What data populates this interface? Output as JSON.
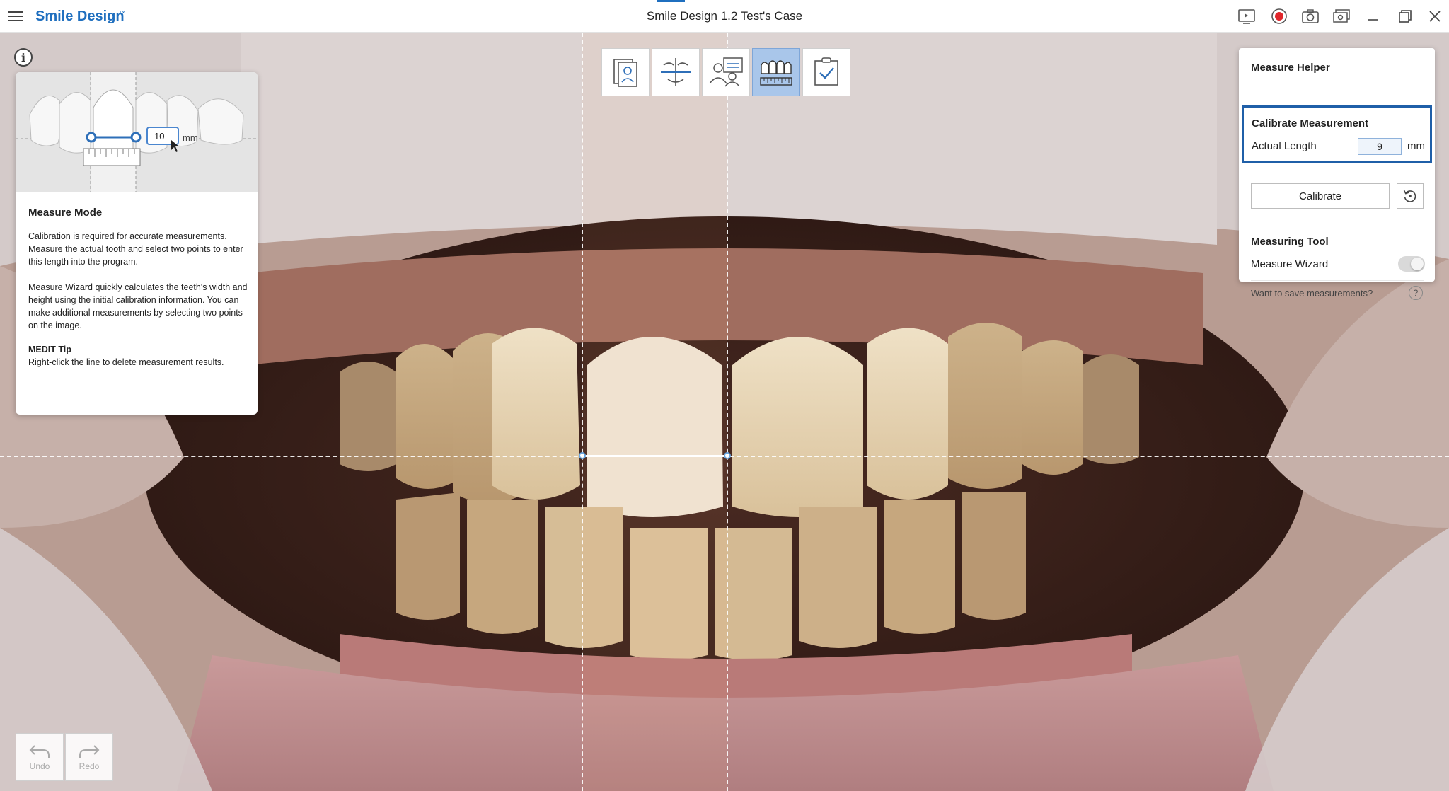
{
  "app": {
    "name": "Smile Design",
    "badge": "™",
    "case_title": "Smile Design 1.2 Test's Case"
  },
  "titlebar_icons": [
    "video-guide-icon",
    "record-icon",
    "camera-icon",
    "screen-capture-icon",
    "minimize-icon",
    "maximize-icon",
    "close-icon"
  ],
  "help_card": {
    "illustration_value": "10",
    "illustration_unit": "mm",
    "heading": "Measure Mode",
    "paragraph1": "Calibration is required for accurate measurements. Measure the actual tooth and select two points to enter this length into the program.",
    "paragraph2": "Measure Wizard quickly calculates the teeth's width and height using the initial calibration information. You can make additional measurements by selecting two points on the image.",
    "tip_title": "MEDIT Tip",
    "tip_text": "Right-click the line to delete measurement results."
  },
  "step_toolbar": [
    {
      "name": "face-photo-step",
      "icon": "face-photo-icon",
      "active": false
    },
    {
      "name": "reference-line-step",
      "icon": "reference-line-icon",
      "active": false
    },
    {
      "name": "photo-match-step",
      "icon": "photo-match-icon",
      "active": false
    },
    {
      "name": "measure-step",
      "icon": "teeth-measure-icon",
      "active": true
    },
    {
      "name": "complete-step",
      "icon": "checklist-icon",
      "active": false
    }
  ],
  "measure_helper": {
    "title": "Measure Helper",
    "calibrate": {
      "title": "Calibrate Measurement",
      "actual_length_label": "Actual Length",
      "actual_length_value": "9",
      "unit": "mm",
      "calibrate_label": "Calibrate"
    },
    "tool": {
      "title": "Measuring Tool",
      "wizard_label": "Measure Wizard",
      "wizard_on": false,
      "save_question": "Want to save measurements?",
      "help_glyph": "?"
    }
  },
  "history": {
    "undo_label": "Undo",
    "redo_label": "Redo"
  },
  "colors": {
    "accent": "#1f6fbf",
    "calibrate_border": "#1f5fa8",
    "active_step": "#a9c6ea"
  }
}
